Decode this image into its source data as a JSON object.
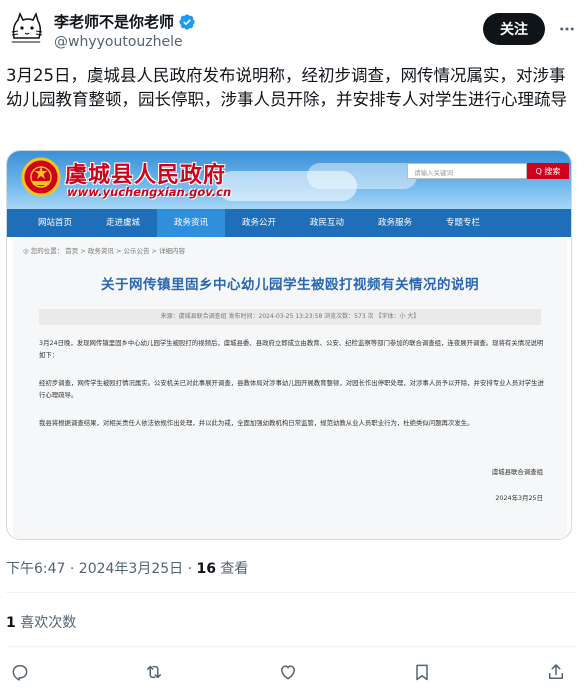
{
  "author": {
    "display_name": "李老师不是你老师",
    "handle": "@whyyoutouzhele",
    "verified": true,
    "follow_label": "关注"
  },
  "tweet": {
    "text": "3月25日，虞城县人民政府发布说明称，经初步调查，网传情况属实，对涉事幼儿园教育整顿，园长停职，涉事人员开除，并安排专人对学生进行心理疏导",
    "time_date": "下午6:47 · 2024年3月25日 · ",
    "views_count": "16",
    "views_label": " 查看",
    "likes_count": "1",
    "likes_label": " 喜欢次数"
  },
  "media": {
    "site_title": "虞城县人民政府",
    "site_url": "www.yuchengxian.gov.cn",
    "search_placeholder": "请输入关键词",
    "search_button": "Q 搜索",
    "nav": [
      "网站首页",
      "走进虞城",
      "政务资讯",
      "政务公开",
      "政民互动",
      "政务服务",
      "专题专栏"
    ],
    "active_nav": "政务资讯",
    "breadcrumb": "◎ 您的位置： 首页 > 政务资讯 > 公示公告 > 详细内容",
    "article_title": "关于网传镇里固乡中心幼儿园学生被殴打视频有关情况的说明",
    "meta_line": "来源：虞城县联合调查组    发布时间：2024-03-25 13:23:58    浏览次数：573 次    【字体：小 大】",
    "paragraphs": [
      "3月24日晚，发现网传镇里固乡中心幼儿园学生被殴打的视频后，虞城县委、县政府立即成立由教育、公安、纪检监察等部门参加的联合调查组，连夜展开调查。现将有关情况说明如下：",
      "经初步调查，网传学生被殴打情况属实。公安机关已对此事展开调查，县教体局对涉事幼儿园开展教育整顿，对园长作出停职处理，对涉事人员予以开除，并安排专业人员对学生进行心理疏导。",
      "我县将根据调查结果，对相关责任人依法依规作出处理，并以此为戒，全面加强幼教机构日常监管，规范幼教从业人员职业行为，杜绝类似问题再次发生。"
    ],
    "signature": "虞城县联合调查组",
    "signature_date": "2024年3月25日"
  },
  "actions": {
    "icons": [
      "reply-icon",
      "retweet-icon",
      "like-icon",
      "bookmark-icon",
      "share-icon"
    ]
  },
  "colors": {
    "follow_bg": "#0f1419",
    "verified": "#1d9bf0",
    "gov_red": "#d0021b",
    "nav_blue": "#1f6fb8"
  }
}
